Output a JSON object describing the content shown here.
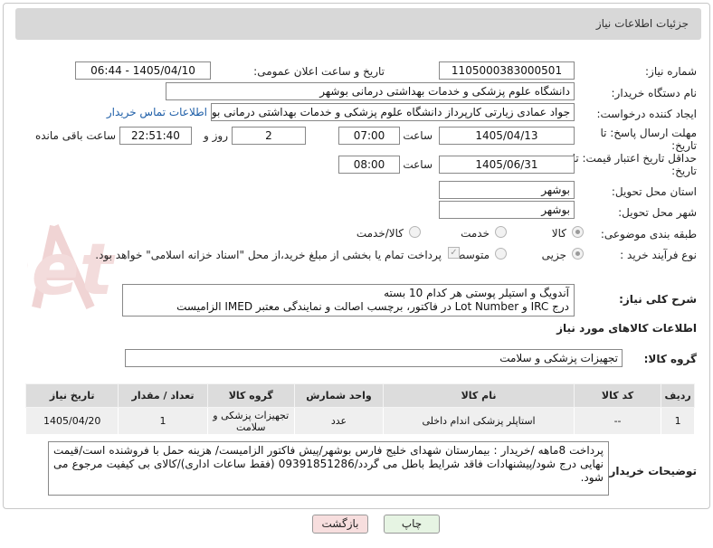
{
  "header": {
    "title": "جزئیات اطلاعات نیاز"
  },
  "labels": {
    "need_number": "شماره نیاز:",
    "announce_datetime": "تاریخ و ساعت اعلان عمومی:",
    "buyer_org": "نام دستگاه خریدار:",
    "requester": "ایجاد کننده درخواست:",
    "reply_deadline": "مهلت ارسال پاسخ: تا تاریخ:",
    "time": "ساعت",
    "day_and": "روز و",
    "remaining": "ساعت باقی مانده",
    "price_validity": "حداقل تاریخ اعتبار قیمت: تا تاریخ:",
    "province": "استان محل تحویل:",
    "city": "شهر محل تحویل:",
    "category": "طبقه بندی موضوعی:",
    "purchase_type": "نوع فرآیند خرید :",
    "description": "شرح کلی نیاز:",
    "goods_info": "اطلاعات کالاهای مورد نیاز",
    "goods_group": "گروه کالا:",
    "buyer_notes": "توضیحات خریدار:"
  },
  "fields": {
    "need_number": "1105000383000501",
    "announce_datetime": "1405/04/10 - 06:44",
    "buyer_org": "دانشگاه علوم پزشکی و خدمات بهداشتی درمانی بوشهر",
    "requester": "جواد عمادی زیارتی کارپرداز دانشگاه علوم پزشکی و خدمات بهداشتی درمانی بو",
    "contact_link": "اطلاعات تماس خریدار",
    "reply_date": "1405/04/13",
    "reply_time": "07:00",
    "days": "2",
    "remaining_time": "22:51:40",
    "validity_date": "1405/06/31",
    "validity_time": "08:00",
    "province": "بوشهر",
    "city": "بوشهر",
    "goods_group": "تجهیزات پزشکی و سلامت"
  },
  "category_options": [
    "کالا",
    "خدمت",
    "کالا/خدمت"
  ],
  "purchase_options": [
    "جزیی",
    "متوسط"
  ],
  "payment_note": "پرداخت تمام یا بخشی از مبلغ خرید،از محل \"اسناد خزانه اسلامی\" خواهد بود.",
  "description_lines": [
    "آندویگ و استیلر پوستی هر کدام 10 بسته",
    "درج IRC و Lot Number در فاکتور، برچسب اصالت و نمایندگی معتبر IMED الزامیست"
  ],
  "table": {
    "headers": [
      "ردیف",
      "کد کالا",
      "نام کالا",
      "واحد شمارش",
      "گروه کالا",
      "تعداد / مقدار",
      "تاریخ نیاز"
    ],
    "rows": [
      [
        "1",
        "--",
        "استاپلر پزشکی اندام داخلی",
        "عدد",
        "تجهیزات پزشکی و سلامت",
        "1",
        "1405/04/20"
      ]
    ]
  },
  "buyer_notes_text": "پرداخت 8ماهه /خریدار : بیمارستان شهدای خلیج فارس بوشهر/پیش فاکتور الزامیست/ هزینه حمل با فروشنده است/قیمت نهایی درج شود/پیشنهادات فاقد شرایط باطل می گردد/09391851286 (فقط ساعات اداری)/کالای بی کیفیت مرجوع می شود.",
  "buttons": {
    "print": "چاپ",
    "back": "بازگشت"
  },
  "colors": {
    "header_bg": "#d8d8d8",
    "link": "#1f5fa8",
    "back_bg": "#f7dede",
    "print_bg": "#e6f4e3"
  }
}
